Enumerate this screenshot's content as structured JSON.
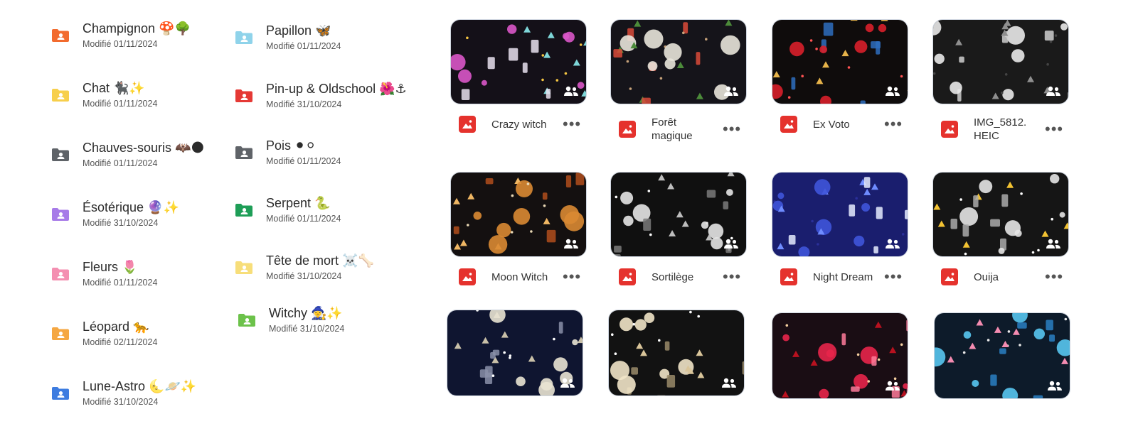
{
  "folders": [
    {
      "name": "Champignon 🍄🌳",
      "date": "Modifié 01/11/2024",
      "color": "#f26b2e"
    },
    {
      "name": "Chat 🐈‍⬛✨",
      "date": "Modifié 01/11/2024",
      "color": "#f7cf4c"
    },
    {
      "name": "Chauves-souris 🦇🌑",
      "date": "Modifié 01/11/2024",
      "color": "#5f6368"
    },
    {
      "name": "Ésotérique 🔮✨",
      "date": "Modifié 31/10/2024",
      "color": "#a77be8"
    },
    {
      "name": "Fleurs 🌷",
      "date": "Modifié 01/11/2024",
      "color": "#f48fb1"
    },
    {
      "name": "Léopard 🐆",
      "date": "Modifié 02/11/2024",
      "color": "#f5a742"
    },
    {
      "name": "Lune-Astro 🌜🪐✨",
      "date": "Modifié 31/10/2024",
      "color": "#3d7ce0"
    },
    {
      "name": "Papillon 🦋",
      "date": "Modifié 01/11/2024",
      "color": "#8fd3ea"
    },
    {
      "name": "Pin-up & Oldschool 🌺⚓",
      "date": "Modifié 31/10/2024",
      "color": "#e53935"
    },
    {
      "name": "Pois ⚫⚪",
      "date": "Modifié 01/11/2024",
      "color": "#5f6368"
    },
    {
      "name": "Serpent 🐍",
      "date": "Modifié 01/11/2024",
      "color": "#1e9e57"
    },
    {
      "name": "Tête de mort ☠️🦴",
      "date": "Modifié 31/10/2024",
      "color": "#f7de7a"
    },
    {
      "name": "Witchy 🧙‍♀️✨",
      "date": "Modifié 31/10/2024",
      "color": "#6cc24a"
    }
  ],
  "files": [
    {
      "name": "Crazy witch",
      "bg": "#141018",
      "accents": [
        "#d957c8",
        "#7ed6d8",
        "#e8e0ef",
        "#f4c542"
      ]
    },
    {
      "name": "Forêt magique",
      "bg": "#15141a",
      "accents": [
        "#e8e4da",
        "#4c8b3a",
        "#d94a3a",
        "#c7a27a"
      ]
    },
    {
      "name": "Ex Voto",
      "bg": "#0f0c0c",
      "accents": [
        "#d81f2a",
        "#e6b34a",
        "#2e6fbf",
        "#ff5353"
      ]
    },
    {
      "name": "IMG_5812. HEIC",
      "bg": "#1a1a1a",
      "accents": [
        "#e9e9e9",
        "#8f8f8f",
        "#cfcfcf",
        "#444"
      ]
    },
    {
      "name": "Moon Witch",
      "bg": "#141010",
      "accents": [
        "#d98a33",
        "#f0b764",
        "#b04d1c",
        "#e8d7b4"
      ]
    },
    {
      "name": "Sortilège",
      "bg": "#101010",
      "accents": [
        "#e6e6e6",
        "#bdbdbd",
        "#7a7a7a",
        "#ffffff"
      ]
    },
    {
      "name": "Night Dream",
      "bg": "#1a1e6e",
      "accents": [
        "#3f54d9",
        "#6f8cff",
        "#e6ecff",
        "#2a2f99"
      ]
    },
    {
      "name": "Ouija",
      "bg": "#151515",
      "accents": [
        "#e4e4e4",
        "#f2c232",
        "#aaaaaa",
        "#ffffff"
      ]
    },
    {
      "name": "",
      "bg": "#0f1530",
      "accents": [
        "#e9e3d3",
        "#c9c0a8",
        "#8a8fa8",
        "#ffffff"
      ]
    },
    {
      "name": "",
      "bg": "#121212",
      "accents": [
        "#f1e4c8",
        "#d9c59a",
        "#9a8b6a",
        "#ffffff"
      ]
    },
    {
      "name": "",
      "bg": "#1a0d14",
      "accents": [
        "#e8254a",
        "#b8111f",
        "#ff7b9a",
        "#f6d0a0"
      ]
    },
    {
      "name": "",
      "bg": "#0d1b2a",
      "accents": [
        "#58c6ef",
        "#f48cb1",
        "#2a7fc2",
        "#e9e9e9"
      ]
    }
  ],
  "icons": {
    "folder": "shared-folder-icon",
    "image": "image-file-icon",
    "shared": "shared-people-icon",
    "more": "more-options-icon"
  },
  "more_glyph": "•••"
}
